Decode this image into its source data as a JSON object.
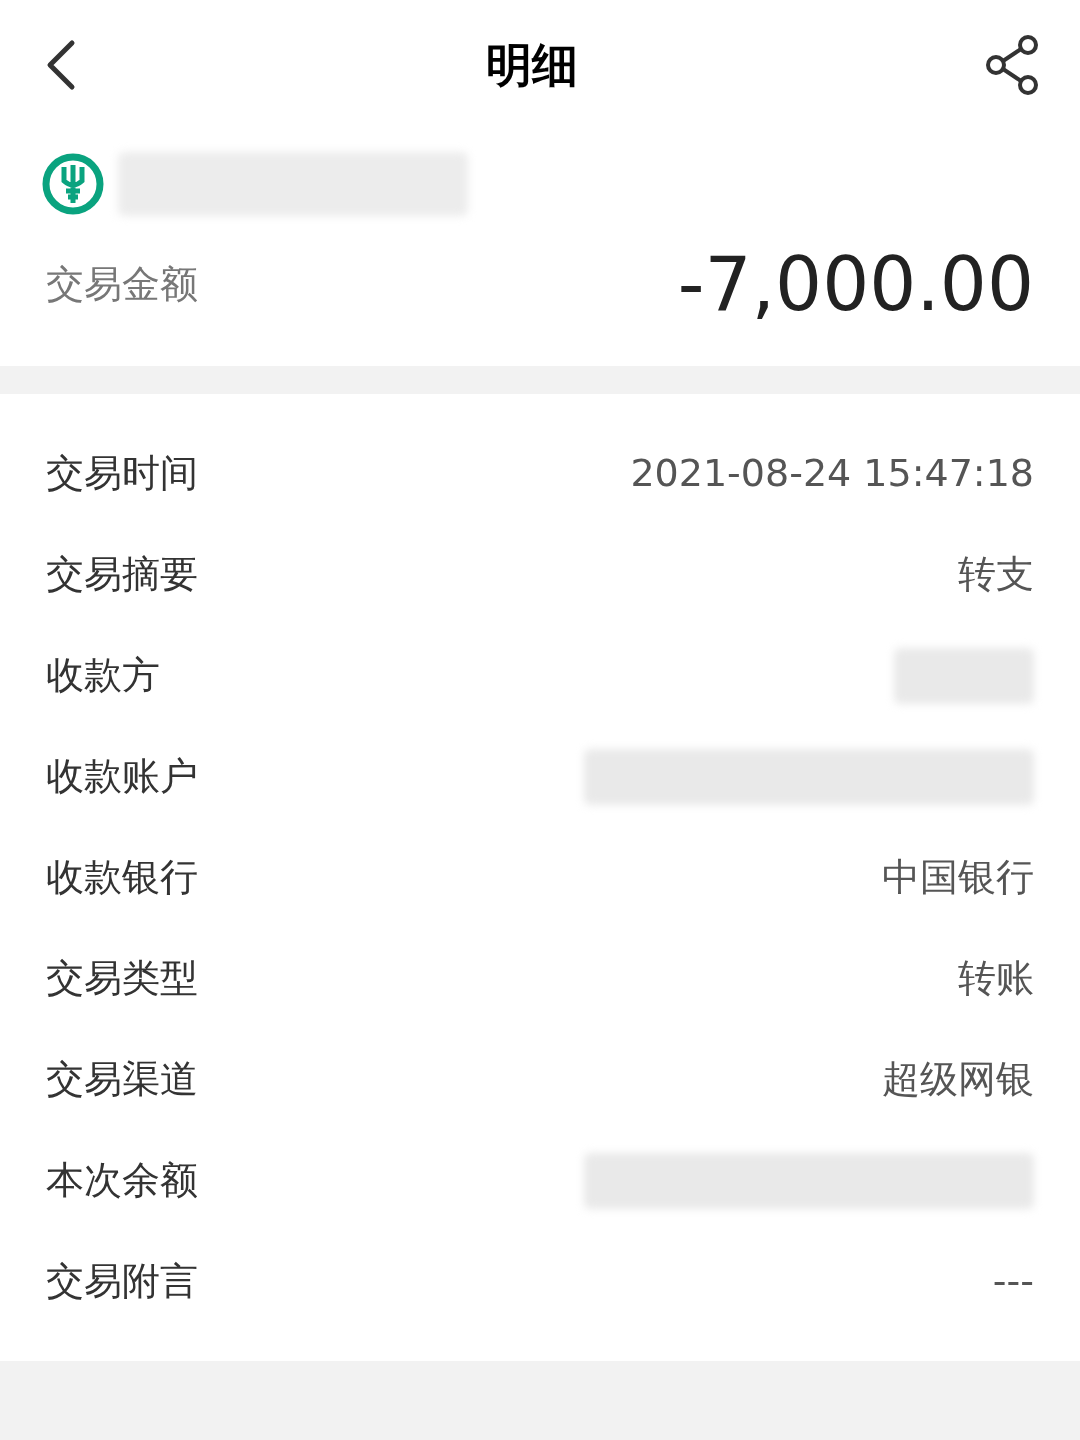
{
  "header": {
    "title": "明细"
  },
  "summary": {
    "amount_label": "交易金额",
    "amount": "-7,000.00"
  },
  "details": [
    {
      "kind": "text",
      "label": "交易时间",
      "value": "2021-08-24 15:47:18"
    },
    {
      "kind": "text",
      "label": "交易摘要",
      "value": "转支"
    },
    {
      "kind": "redacted",
      "label": "收款方"
    },
    {
      "kind": "redacted",
      "label": "收款账户"
    },
    {
      "kind": "text",
      "label": "收款银行",
      "value": "中国银行"
    },
    {
      "kind": "text",
      "label": "交易类型",
      "value": "转账"
    },
    {
      "kind": "text",
      "label": "交易渠道",
      "value": "超级网银"
    },
    {
      "kind": "redacted",
      "label": "本次余额"
    },
    {
      "kind": "text",
      "label": "交易附言",
      "value": "---"
    }
  ]
}
